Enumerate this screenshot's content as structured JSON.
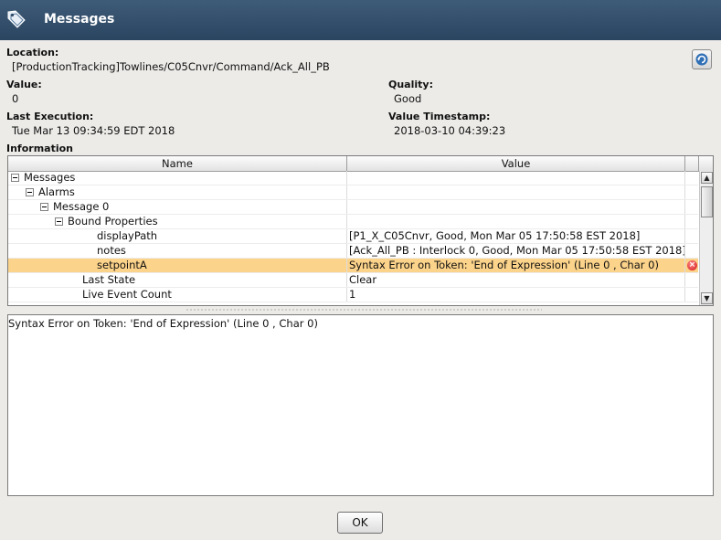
{
  "window": {
    "title": "Messages"
  },
  "location": {
    "label": "Location:",
    "value": "[ProductionTracking]Towlines/C05Cnvr/Command/Ack_All_PB"
  },
  "value": {
    "label": "Value:",
    "value": "0"
  },
  "quality": {
    "label": "Quality:",
    "value": "Good"
  },
  "last_execution": {
    "label": "Last Execution:",
    "value": "Tue Mar 13 09:34:59 EDT 2018"
  },
  "value_timestamp": {
    "label": "Value Timestamp:",
    "value": "2018-03-10 04:39:23"
  },
  "information": {
    "label": "Information"
  },
  "table": {
    "columns": [
      "Name",
      "Value"
    ],
    "rows": [
      {
        "name": "Messages",
        "value": "",
        "level": 0,
        "toggle": true,
        "selected": false,
        "error": false
      },
      {
        "name": "Alarms",
        "value": "",
        "level": 1,
        "toggle": true,
        "selected": false,
        "error": false
      },
      {
        "name": "Message 0",
        "value": "",
        "level": 2,
        "toggle": true,
        "selected": false,
        "error": false
      },
      {
        "name": "Bound Properties",
        "value": "",
        "level": 3,
        "toggle": true,
        "selected": false,
        "error": false
      },
      {
        "name": "displayPath",
        "value": "[P1_X_C05Cnvr, Good, Mon Mar 05 17:50:58 EST 2018]",
        "level": 5,
        "toggle": false,
        "selected": false,
        "error": false
      },
      {
        "name": "notes",
        "value": "[Ack_All_PB : Interlock 0, Good, Mon Mar 05 17:50:58 EST 2018]",
        "level": 5,
        "toggle": false,
        "selected": false,
        "error": false
      },
      {
        "name": "setpointA",
        "value": "Syntax Error on Token: 'End of Expression' (Line 0 , Char 0)",
        "level": 5,
        "toggle": false,
        "selected": true,
        "error": true
      },
      {
        "name": "Last State",
        "value": "Clear",
        "level": 4,
        "toggle": false,
        "selected": false,
        "error": false
      },
      {
        "name": "Live Event Count",
        "value": "1",
        "level": 4,
        "toggle": false,
        "selected": false,
        "error": false
      }
    ]
  },
  "detail": {
    "text": "Syntax Error on Token: 'End of Expression' (Line 0 , Char 0)"
  },
  "ok_label": "OK",
  "icons": {
    "title": "tag-icon",
    "refresh": "refresh-icon",
    "error": "error-icon"
  },
  "colors": {
    "titlebar": "#2f4b66",
    "selection": "#fcd38a",
    "error": "#d11414"
  }
}
